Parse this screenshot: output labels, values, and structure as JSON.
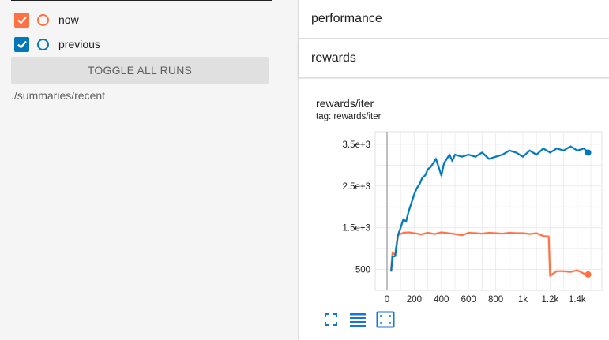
{
  "runs": [
    {
      "label": "now",
      "color": "#ff7043",
      "checked": true
    },
    {
      "label": "previous",
      "color": "#0077bb",
      "checked": true
    }
  ],
  "toggle_all_label": "TOGGLE ALL RUNS",
  "log_dir": "./summaries/recent",
  "categories": [
    {
      "label": "performance"
    },
    {
      "label": "rewards"
    }
  ],
  "card": {
    "title": "rewards/iter",
    "tag": "tag: rewards/iter"
  },
  "icons": [
    "fit-domain-icon",
    "data-selection-icon",
    "toggle-log-scale-icon"
  ],
  "accent_color": "#1976d2",
  "chart_data": {
    "type": "line",
    "title": "rewards/iter",
    "xlabel": "",
    "ylabel": "",
    "xlim": [
      0,
      1500
    ],
    "ylim": [
      0,
      3800
    ],
    "x_ticks": [
      0,
      200,
      400,
      600,
      800,
      1000,
      1200,
      1400
    ],
    "x_tick_labels": [
      "0",
      "200",
      "400",
      "600",
      "800",
      "1k",
      "1.2k",
      "1.4k"
    ],
    "y_ticks": [
      500,
      1500,
      2500,
      3500
    ],
    "y_tick_labels": [
      "500",
      "1.5e+3",
      "2.5e+3",
      "3.5e+3"
    ],
    "grid": true,
    "series": [
      {
        "name": "now",
        "color": "#ff7043",
        "x": [
          30,
          40,
          60,
          80,
          120,
          160,
          200,
          250,
          300,
          350,
          400,
          450,
          500,
          550,
          600,
          650,
          700,
          750,
          800,
          850,
          900,
          950,
          1000,
          1050,
          1100,
          1150,
          1190,
          1200,
          1250,
          1300,
          1350,
          1400,
          1450,
          1480
        ],
        "y": [
          450,
          900,
          850,
          1320,
          1380,
          1390,
          1370,
          1340,
          1380,
          1350,
          1390,
          1370,
          1350,
          1320,
          1380,
          1370,
          1360,
          1380,
          1370,
          1360,
          1380,
          1370,
          1370,
          1350,
          1370,
          1300,
          1290,
          350,
          460,
          460,
          440,
          480,
          400,
          380
        ]
      },
      {
        "name": "previous",
        "color": "#0077bb",
        "x": [
          30,
          40,
          60,
          80,
          100,
          120,
          140,
          160,
          180,
          200,
          220,
          240,
          260,
          280,
          300,
          320,
          340,
          360,
          380,
          400,
          420,
          440,
          460,
          480,
          500,
          550,
          600,
          650,
          700,
          750,
          800,
          850,
          900,
          950,
          1000,
          1050,
          1100,
          1150,
          1200,
          1250,
          1300,
          1350,
          1400,
          1450,
          1480
        ],
        "y": [
          450,
          800,
          820,
          1320,
          1500,
          1700,
          1650,
          1900,
          2100,
          2300,
          2450,
          2550,
          2700,
          2750,
          2900,
          2950,
          3050,
          3150,
          2950,
          2750,
          3050,
          3150,
          3250,
          3100,
          3250,
          3200,
          3250,
          3200,
          3300,
          3150,
          3200,
          3250,
          3350,
          3300,
          3200,
          3350,
          3250,
          3400,
          3300,
          3400,
          3350,
          3450,
          3350,
          3400,
          3300
        ]
      }
    ]
  }
}
